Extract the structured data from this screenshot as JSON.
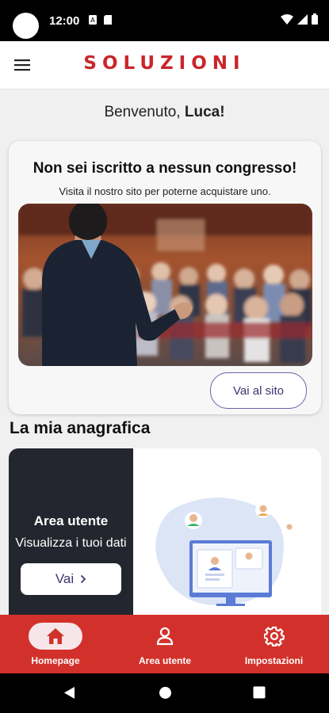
{
  "status_bar": {
    "time": "12:00"
  },
  "app_bar": {
    "brand": "SOLUZIONI"
  },
  "welcome": {
    "greeting": "Benvenuto, ",
    "user_name": "Luca!"
  },
  "congress_card": {
    "title": "Non sei iscritto a nessun congresso!",
    "subtitle": "Visita il nostro sito per poterne acquistare uno.",
    "button_label": "Vai al sito"
  },
  "section": {
    "title": "La mia anagrafica"
  },
  "user_area": {
    "title": "Area utente",
    "subtitle": "Visualizza i tuoi dati",
    "button_label": "Vai",
    "button_icon": "chevron-right-icon"
  },
  "bottom_nav": {
    "items": [
      {
        "label": "Homepage",
        "icon": "home-icon",
        "active": true
      },
      {
        "label": "Area utente",
        "icon": "person-icon",
        "active": false
      },
      {
        "label": "Impostazioni",
        "icon": "gear-icon",
        "active": false
      }
    ]
  },
  "colors": {
    "brand_red": "#d2312b",
    "accent_purple": "#3c3473",
    "dark_panel": "#23262e"
  }
}
